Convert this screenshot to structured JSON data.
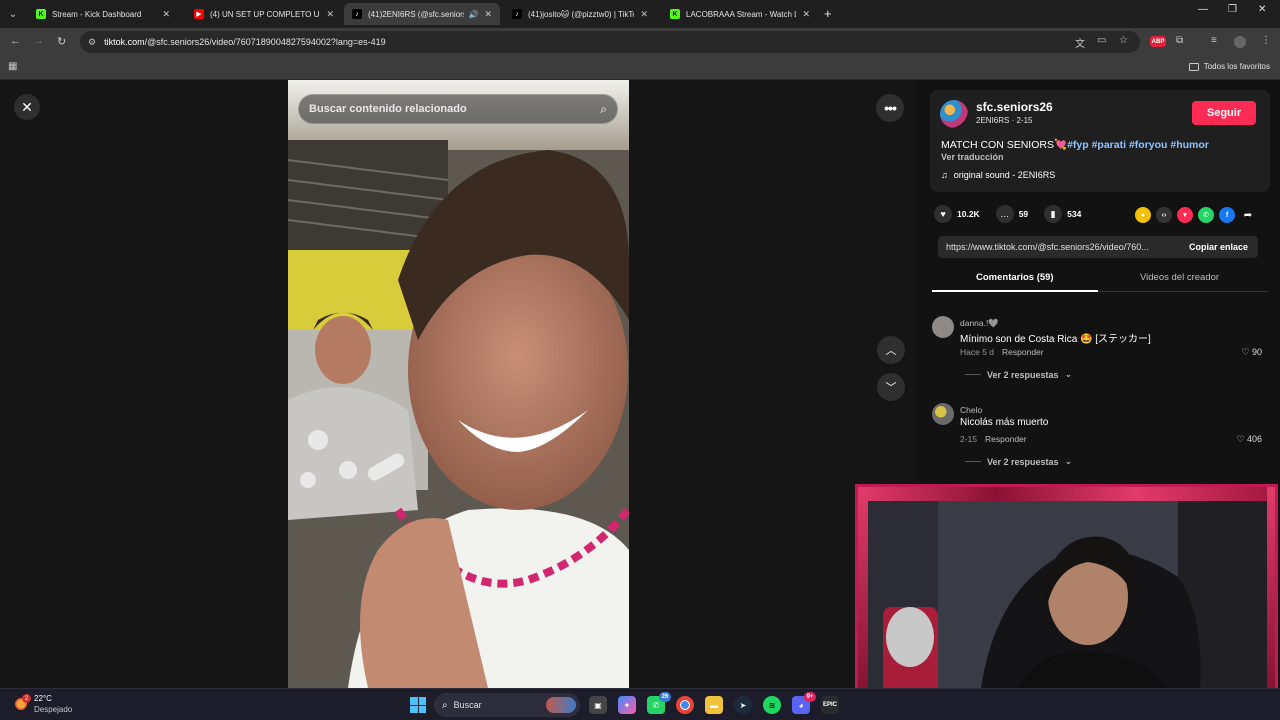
{
  "browser": {
    "tabs": [
      {
        "title": "Stream - Kick Dashboard",
        "favicon": "kick-icon",
        "color": "#53fc18",
        "active": false
      },
      {
        "title": "(4) UN SET UP COMPLETO UN",
        "favicon": "youtube-icon",
        "color": "#ff0000",
        "active": false
      },
      {
        "title": "(41)2ENI6RS (@sfc.seniors2",
        "favicon": "tiktok-icon",
        "color": "#ffffff",
        "active": true
      },
      {
        "title": "(41)josito🐱 (@pizztw0) | TikTo",
        "favicon": "tiktok-icon",
        "color": "#ffffff",
        "active": false
      },
      {
        "title": "LACOBRAAA Stream - Watch Li",
        "favicon": "kick-icon",
        "color": "#53fc18",
        "active": false
      }
    ],
    "url": {
      "domain": "tiktok.com",
      "path": "/@sfc.seniors26/video/7607189004827594002?lang=es-419"
    },
    "extensions": {
      "abp": "ABP"
    },
    "bookmarks_label": "Todos los favoritos"
  },
  "player": {
    "search_placeholder": "Buscar contenido relacionado"
  },
  "post": {
    "username": "sfc.seniors26",
    "subtitle": "2ENI6RS · 2-15",
    "follow_label": "Seguir",
    "caption_text": "MATCH CON SENIORS",
    "caption_emoji": "💘",
    "hashtags": [
      "#fyp",
      "#parati",
      "#foryou",
      "#humor"
    ],
    "translate_label": "Ver traducción",
    "sound": "original sound - 2ENI6RS",
    "likes": "10.2K",
    "comments_count": "59",
    "saves": "534",
    "link": "https://www.tiktok.com/@sfc.seniors26/video/760...",
    "copy_label": "Copiar enlace",
    "tab_comments": "Comentarios (59)",
    "tab_creator": "Videos del creador"
  },
  "comments": [
    {
      "name": "danna.!🩶",
      "text": "Mínimo son de Costa Rica 🤩 [ステッカー]",
      "time": "Hace 5 d",
      "reply": "Responder",
      "likes": "90",
      "view_replies": "Ver 2 respuestas"
    },
    {
      "name": "Chelo",
      "text": "Nicolás más muerto",
      "time": "2-15",
      "reply": "Responder",
      "likes": "406",
      "view_replies": "Ver 2 respuestas"
    }
  ],
  "taskbar": {
    "weather_badge": "2",
    "temp": "22°C",
    "condition": "Despejado",
    "search_label": "Buscar",
    "whatsapp_badge": "26",
    "discord_badge": "9+"
  }
}
